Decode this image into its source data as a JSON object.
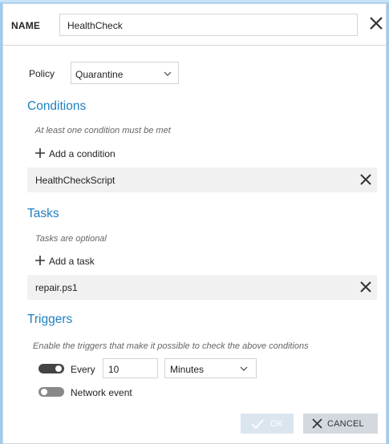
{
  "header": {
    "name_label": "NAME",
    "name_value": "HealthCheck",
    "close_icon": "close-icon"
  },
  "policy": {
    "label": "Policy",
    "selected": "Quarantine"
  },
  "conditions": {
    "title": "Conditions",
    "hint": "At least one condition must be met",
    "add_label": "Add a condition",
    "items": [
      {
        "label": "HealthCheckScript"
      }
    ]
  },
  "tasks": {
    "title": "Tasks",
    "hint": "Tasks are optional",
    "add_label": "Add a task",
    "items": [
      {
        "label": "repair.ps1"
      }
    ]
  },
  "triggers": {
    "title": "Triggers",
    "hint": "Enable the triggers that make it possible to check the above conditions",
    "every": {
      "enabled": true,
      "label": "Every",
      "value": "10",
      "unit": "Minutes"
    },
    "network": {
      "enabled": false,
      "label": "Network event"
    }
  },
  "footer": {
    "ok_label": "OK",
    "cancel_label": "CANCEL"
  },
  "colors": {
    "accent": "#1f7fc1",
    "background": "#9fcbee"
  }
}
